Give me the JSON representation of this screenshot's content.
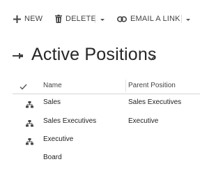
{
  "toolbar": {
    "new_label": "NEW",
    "delete_label": "DELETE",
    "email_link_label": "EMAIL A LINK"
  },
  "view": {
    "title": "Active Positions"
  },
  "grid": {
    "columns": {
      "name": "Name",
      "parent": "Parent Position"
    },
    "rows": [
      {
        "name": "Sales",
        "parent": "Sales Executives",
        "icon": "hierarchy-icon"
      },
      {
        "name": "Sales Executives",
        "parent": "Executive",
        "icon": "hierarchy-icon"
      },
      {
        "name": "Executive",
        "parent": "",
        "icon": "hierarchy-icon"
      },
      {
        "name": "Board",
        "parent": "",
        "icon": ""
      }
    ]
  },
  "colors": {
    "text": "#333333",
    "icon": "#444444",
    "divider": "#d6d6d6"
  }
}
